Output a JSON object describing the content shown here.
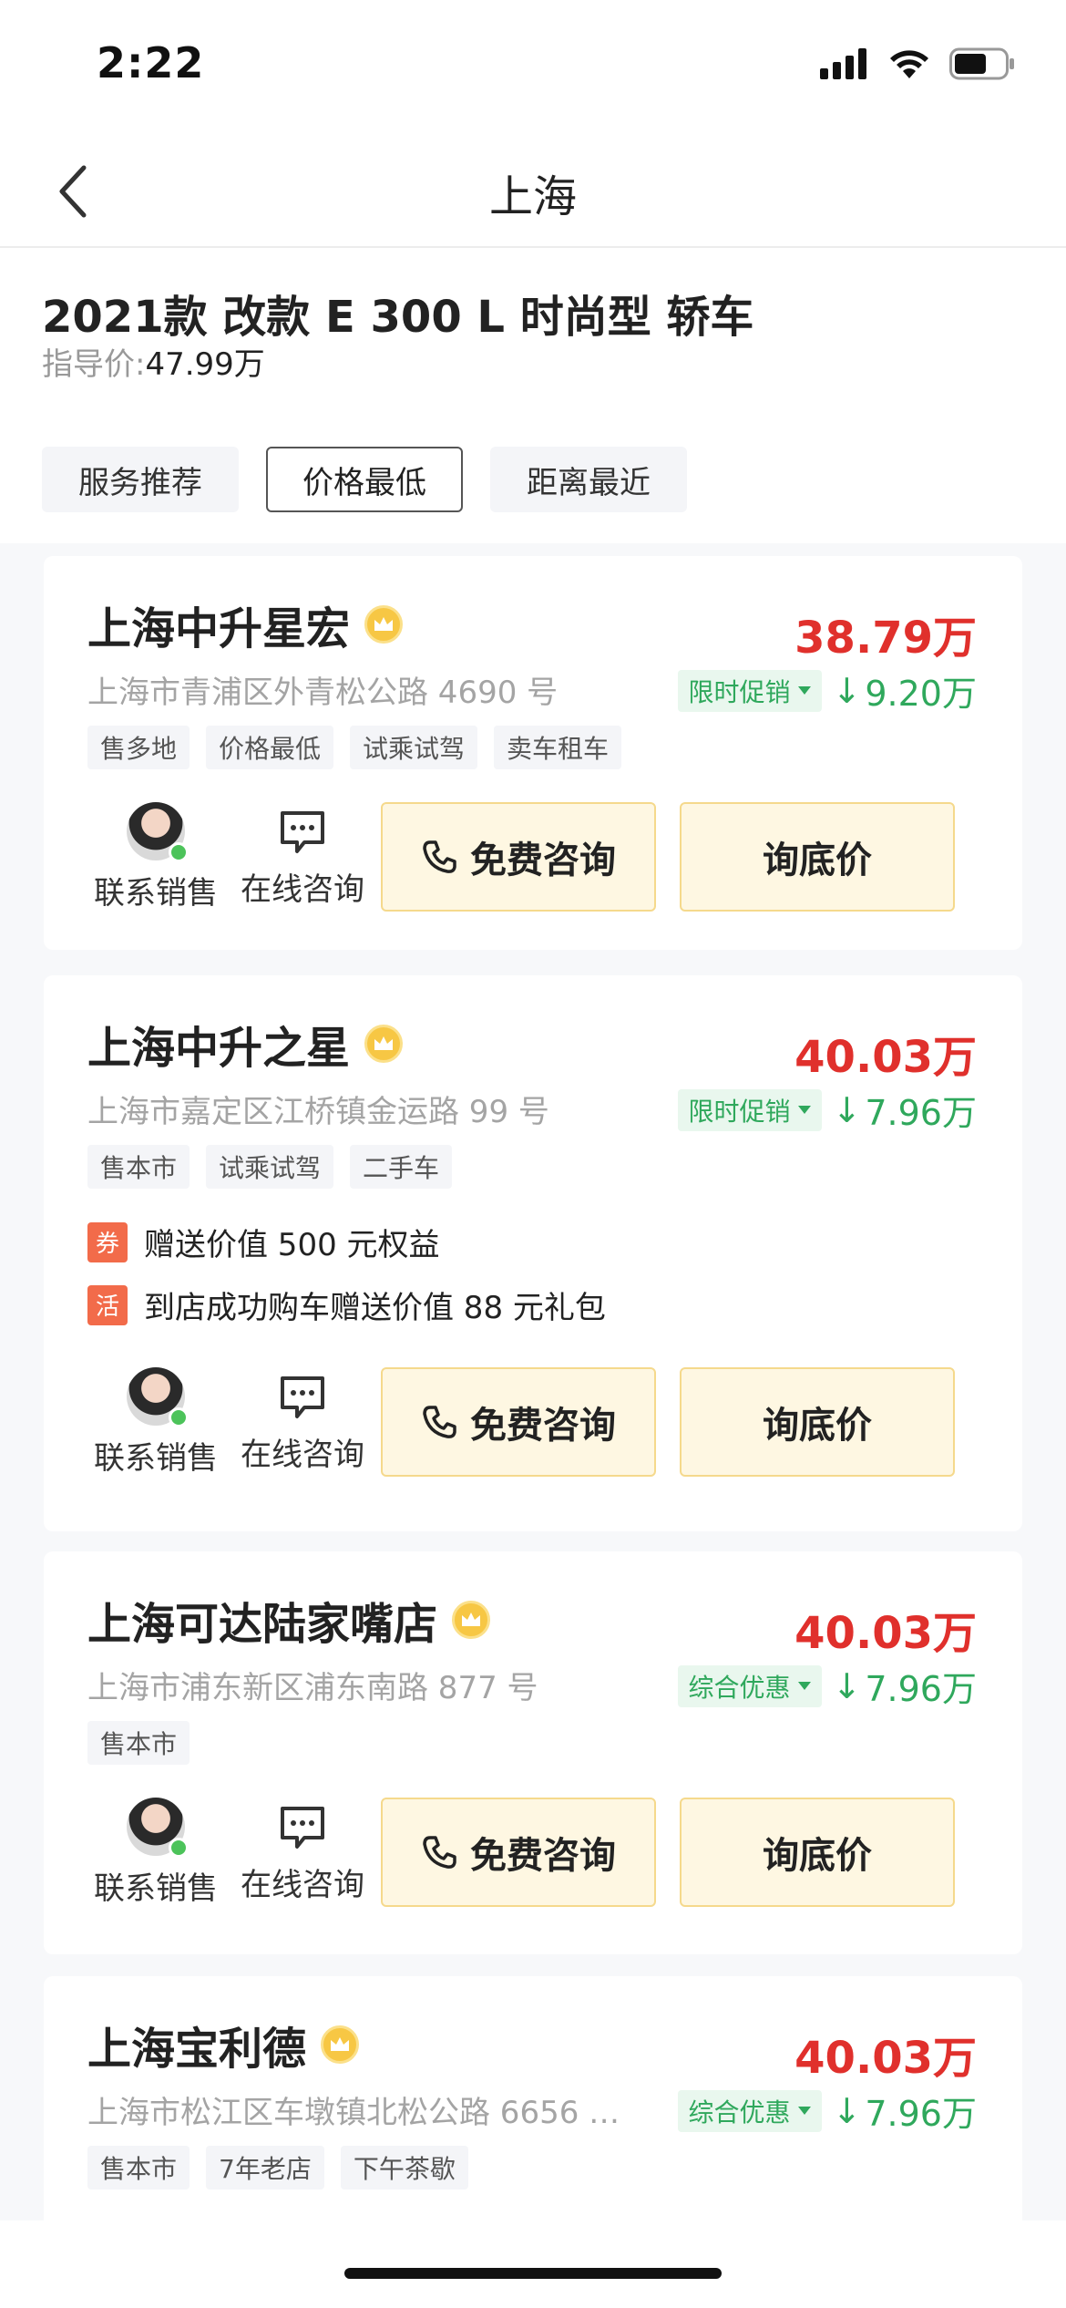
{
  "status": {
    "time": "2:22"
  },
  "nav": {
    "title": "上海"
  },
  "car": {
    "title": "2021款 改款 E 300 L 时尚型 轿车",
    "guide_label": "指导价:",
    "guide_value": "47.99万"
  },
  "sort_tabs": [
    "服务推荐",
    "价格最低",
    "距离最近"
  ],
  "sort_active": 1,
  "labels": {
    "contact_sales": "联系销售",
    "online_consult": "在线咨询",
    "free_consult": "免费咨询",
    "lowest_price": "询底价"
  },
  "colors": {
    "price_red": "#e0302c",
    "discount_green": "#2fa85c",
    "button_bg": "#fef7e2",
    "perk_orange": "#f26b4a"
  },
  "dealers": [
    {
      "name": "上海中升星宏",
      "address": "上海市青浦区外青松公路 4690 号",
      "price": "38.79万",
      "promo": "限时促销",
      "discount": "9.20万",
      "tags": [
        "售多地",
        "价格最低",
        "试乘试驾",
        "卖车租车"
      ],
      "perks": []
    },
    {
      "name": "上海中升之星",
      "address": "上海市嘉定区江桥镇金运路 99 号",
      "price": "40.03万",
      "promo": "限时促销",
      "discount": "7.96万",
      "tags": [
        "售本市",
        "试乘试驾",
        "二手车"
      ],
      "perks": [
        {
          "icon": "券",
          "text": "赠送价值 500 元权益"
        },
        {
          "icon": "活",
          "text": "到店成功购车赠送价值 88 元礼包"
        }
      ]
    },
    {
      "name": "上海可达陆家嘴店",
      "address": "上海市浦东新区浦东南路 877 号",
      "price": "40.03万",
      "promo": "综合优惠",
      "discount": "7.96万",
      "tags": [
        "售本市"
      ],
      "perks": []
    },
    {
      "name": "上海宝利德",
      "address": "上海市松江区车墩镇北松公路 6656 …",
      "price": "40.03万",
      "promo": "综合优惠",
      "discount": "7.96万",
      "tags": [
        "售本市",
        "7年老店",
        "下午茶歇"
      ],
      "perks": []
    }
  ]
}
